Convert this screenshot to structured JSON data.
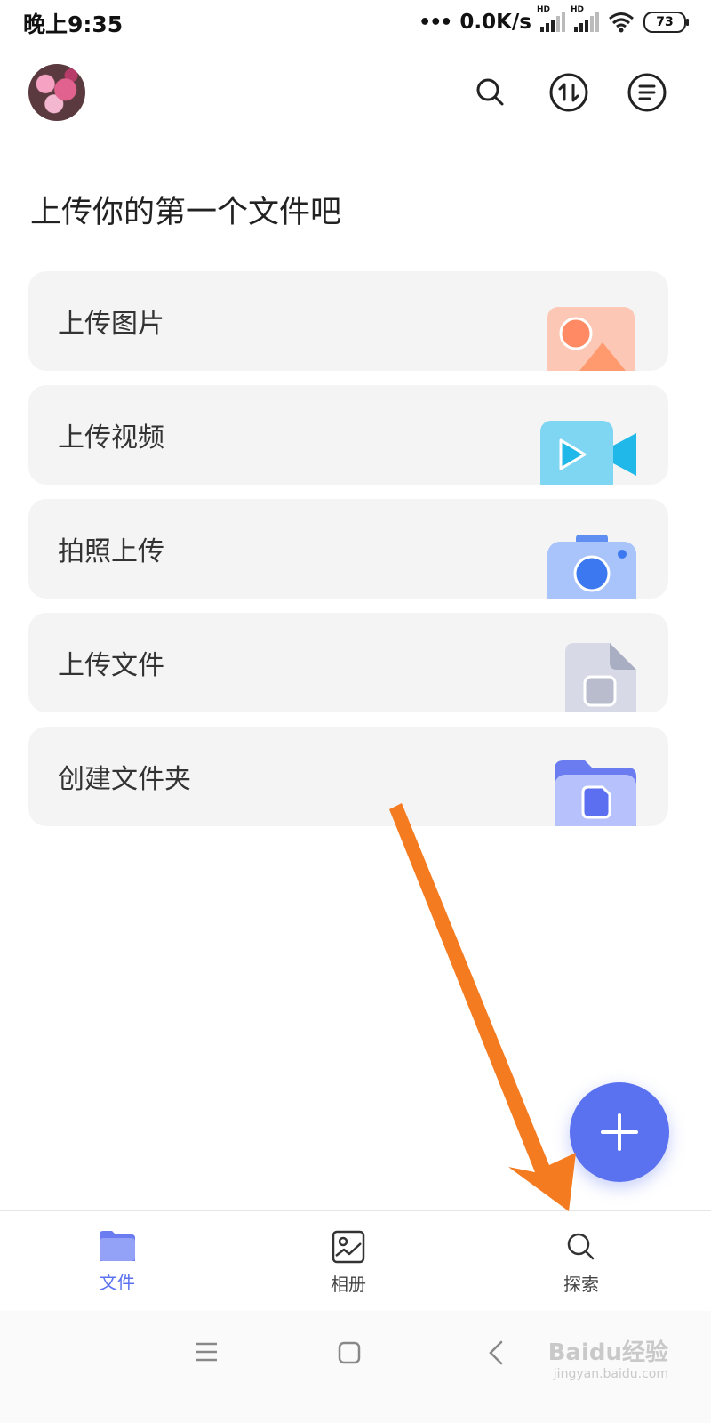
{
  "status_bar": {
    "time": "晚上9:35",
    "net_speed": "0.0K/s",
    "signal_tag": "HD",
    "battery": "73"
  },
  "header": {
    "icons": [
      "search-icon",
      "transfer-icon",
      "menu-list-icon"
    ]
  },
  "page_title": "上传你的第一个文件吧",
  "cards": [
    {
      "label": "上传图片",
      "icon": "image-icon"
    },
    {
      "label": "上传视频",
      "icon": "video-icon"
    },
    {
      "label": "拍照上传",
      "icon": "camera-icon"
    },
    {
      "label": "上传文件",
      "icon": "file-icon"
    },
    {
      "label": "创建文件夹",
      "icon": "folder-icon"
    }
  ],
  "fab": {
    "icon": "plus-icon"
  },
  "bottom_nav": {
    "items": [
      {
        "label": "文件",
        "icon": "folder-icon",
        "active": true
      },
      {
        "label": "相册",
        "icon": "album-icon",
        "active": false
      },
      {
        "label": "探索",
        "icon": "search-icon",
        "active": false
      }
    ]
  },
  "watermark": {
    "brand": "Baidu经验",
    "url": "jingyan.baidu.com"
  },
  "colors": {
    "accent": "#5b72f0",
    "card_bg": "#f4f4f4",
    "annotation_arrow": "#f47b20"
  }
}
